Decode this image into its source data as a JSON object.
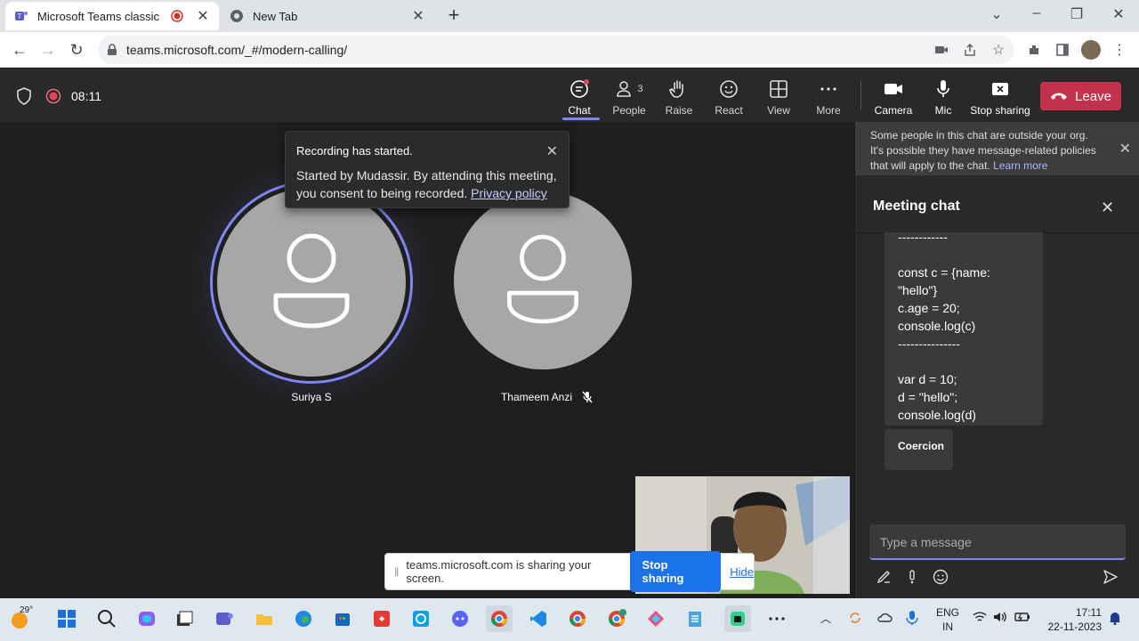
{
  "browser": {
    "tabs": [
      {
        "title": "Microsoft Teams classic",
        "active": true
      },
      {
        "title": "New Tab",
        "active": false
      }
    ],
    "url": "teams.microsoft.com/_#/modern-calling/"
  },
  "meeting": {
    "timer": "08:11",
    "toolbar": {
      "chat": "Chat",
      "people": "People",
      "people_count": "3",
      "raise": "Raise",
      "react": "React",
      "view": "View",
      "more": "More",
      "camera": "Camera",
      "mic": "Mic",
      "stop_sharing": "Stop sharing",
      "leave": "Leave"
    },
    "toast": {
      "title": "Recording has started.",
      "body": "Started by Mudassir. By attending this meeting, you consent to being recorded.",
      "link": "Privacy policy"
    },
    "participants": [
      {
        "name": "Suriya S",
        "muted": false,
        "speaking": true
      },
      {
        "name": "Thameem Anzi",
        "muted": true,
        "speaking": false
      }
    ],
    "share_bar": {
      "text": "teams.microsoft.com is sharing your screen.",
      "stop": "Stop sharing",
      "hide": "Hide"
    }
  },
  "chat_panel": {
    "notice": "Some people in this chat are outside your org. It's possible they have message-related policies that will apply to the chat.",
    "notice_link": "Learn more",
    "title": "Meeting chat",
    "message_lines": [
      "------------",
      "",
      "const c = {name: \"hello\"}",
      "c.age = 20;",
      "console.log(c)",
      "---------------",
      "",
      "var d = 10;",
      "d = \"hello\";",
      "console.log(d)",
      "------------"
    ],
    "message2": "Coercion",
    "compose_placeholder": "Type a message"
  },
  "taskbar": {
    "weather": "29°",
    "lang1": "ENG",
    "lang2": "IN",
    "time": "17:11",
    "date": "22-11-2023"
  },
  "colors": {
    "accent": "#7f85f5",
    "leave": "#c4314b",
    "share_button": "#1a73e8"
  }
}
